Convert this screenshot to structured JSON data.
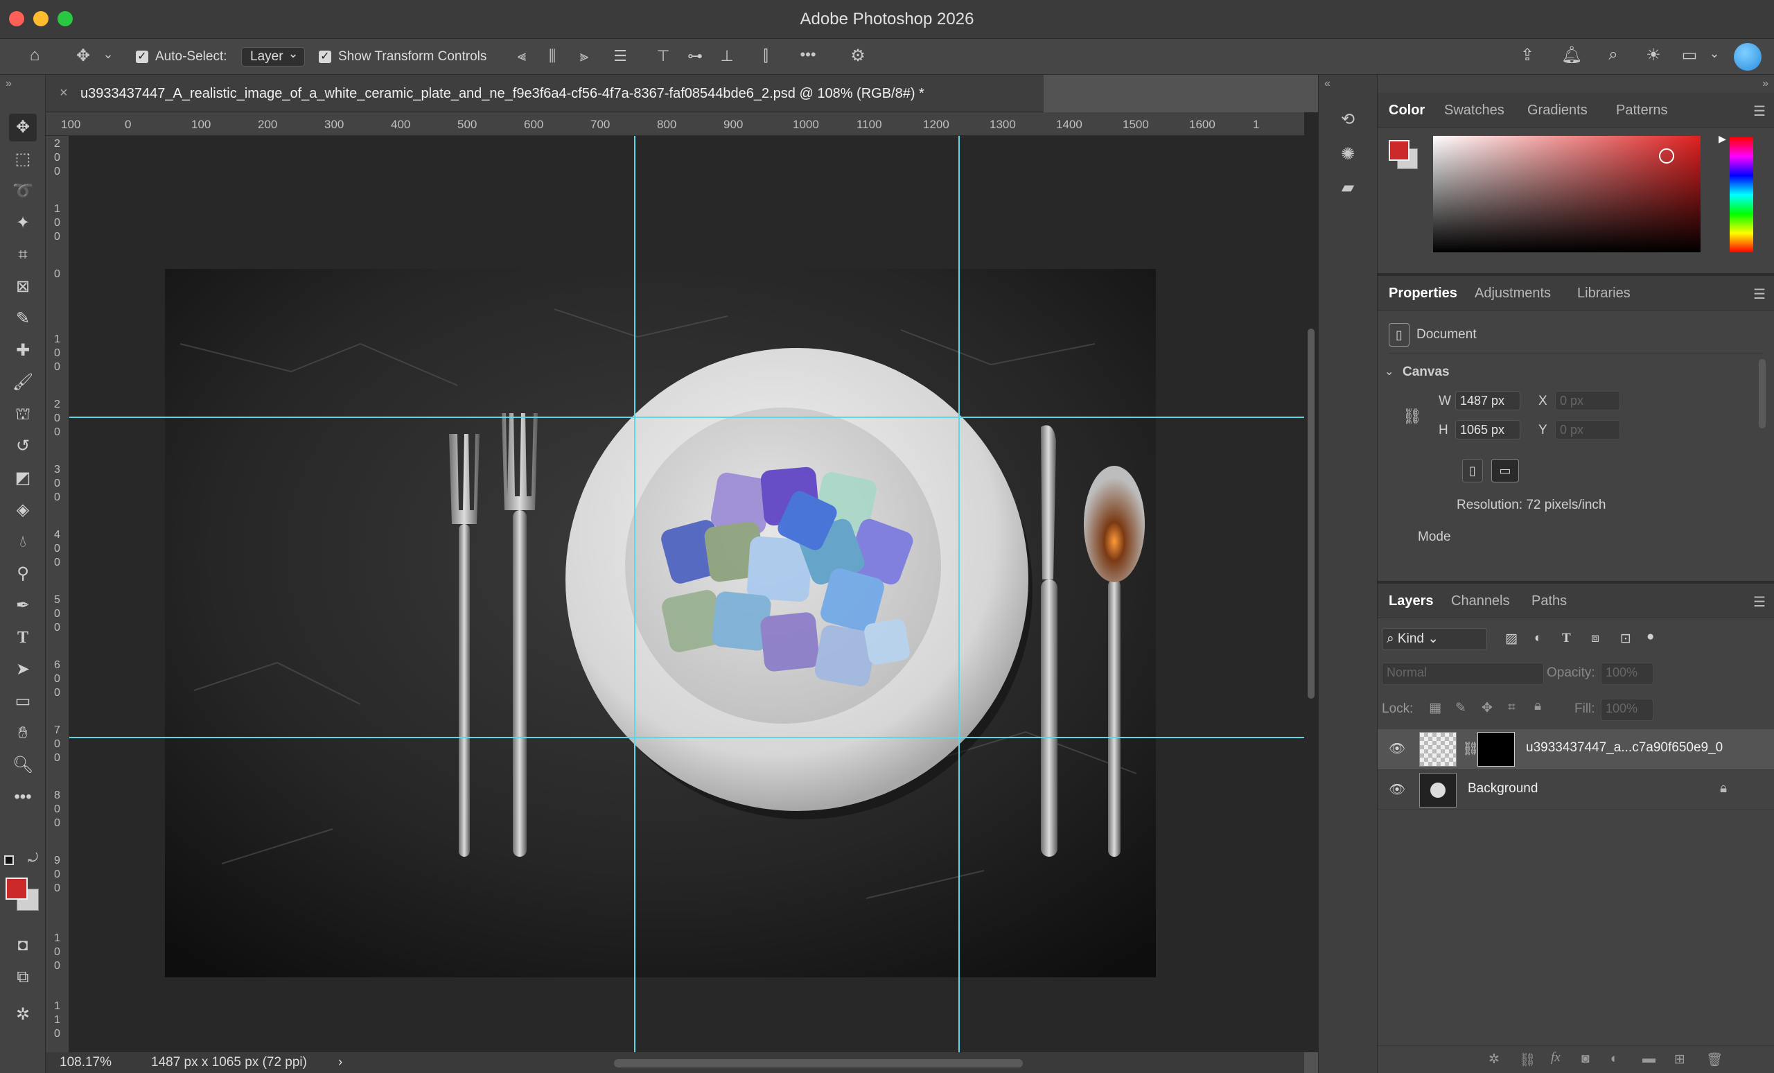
{
  "app": {
    "title": "Adobe Photoshop 2026"
  },
  "options_bar": {
    "auto_select_label": "Auto-Select:",
    "auto_select_value": "Layer",
    "show_transform_label": "Show Transform Controls",
    "more_label": "•••"
  },
  "document": {
    "tab_title": "u3933437447_A_realistic_image_of_a_white_ceramic_plate_and_ne_f9e3f6a4-cf56-4f7a-8367-faf08544bde6_2.psd @ 108% (RGB/8#) *",
    "close_label": "×"
  },
  "rulers": {
    "h_labels": [
      "100",
      "0",
      "100",
      "200",
      "300",
      "400",
      "500",
      "600",
      "700",
      "800",
      "900",
      "1000",
      "1100",
      "1200",
      "1300",
      "1400",
      "1500",
      "1600",
      "1"
    ],
    "v_labels": [
      "2\n0\n0",
      "1\n0\n0",
      "0",
      "1\n0\n0",
      "2\n0\n0",
      "3\n0\n0",
      "4\n0\n0",
      "5\n0\n0",
      "6\n0\n0",
      "7\n0\n0",
      "8\n0\n0",
      "9\n0\n0",
      "1\n0\n0",
      "1\n1\n0"
    ]
  },
  "status": {
    "zoom": "108.17%",
    "info": "1487 px x 1065 px (72 ppi)",
    "arrow": "›"
  },
  "color_panel": {
    "tabs": [
      "Color",
      "Swatches",
      "Gradients",
      "Patterns"
    ],
    "foreground": "#cc2a2a",
    "background": "#d0d0d0"
  },
  "properties_panel": {
    "tabs": [
      "Properties",
      "Adjustments",
      "Libraries"
    ],
    "doc_label": "Document",
    "section": "Canvas",
    "w_label": "W",
    "w_value": "1487 px",
    "h_label": "H",
    "h_value": "1065 px",
    "x_label": "X",
    "x_placeholder": "0 px",
    "y_label": "Y",
    "y_placeholder": "0 px",
    "resolution": "Resolution: 72 pixels/inch",
    "mode_label": "Mode"
  },
  "layers_panel": {
    "tabs": [
      "Layers",
      "Channels",
      "Paths"
    ],
    "filter_value": "Kind",
    "blend_mode": "Normal",
    "opacity_label": "Opacity:",
    "opacity_value": "100%",
    "lock_label": "Lock:",
    "fill_label": "Fill:",
    "fill_value": "100%",
    "layers": [
      {
        "name": "u3933437447_a...c7a90f650e9_0"
      },
      {
        "name": "Background"
      }
    ]
  },
  "toolbar_icons": [
    "move-tool-icon",
    "marquee-tool-icon",
    "lasso-tool-icon",
    "magic-wand-icon",
    "crop-tool-icon",
    "frame-tool-icon",
    "eyedropper-icon",
    "healing-brush-icon",
    "brush-tool-icon",
    "stamp-tool-icon",
    "history-brush-icon",
    "eraser-icon",
    "paint-bucket-icon",
    "blur-tool-icon",
    "dodge-tool-icon",
    "pen-tool-icon",
    "type-tool-icon",
    "path-select-icon",
    "rectangle-tool-icon",
    "hand-tool-icon",
    "zoom-tool-icon"
  ]
}
